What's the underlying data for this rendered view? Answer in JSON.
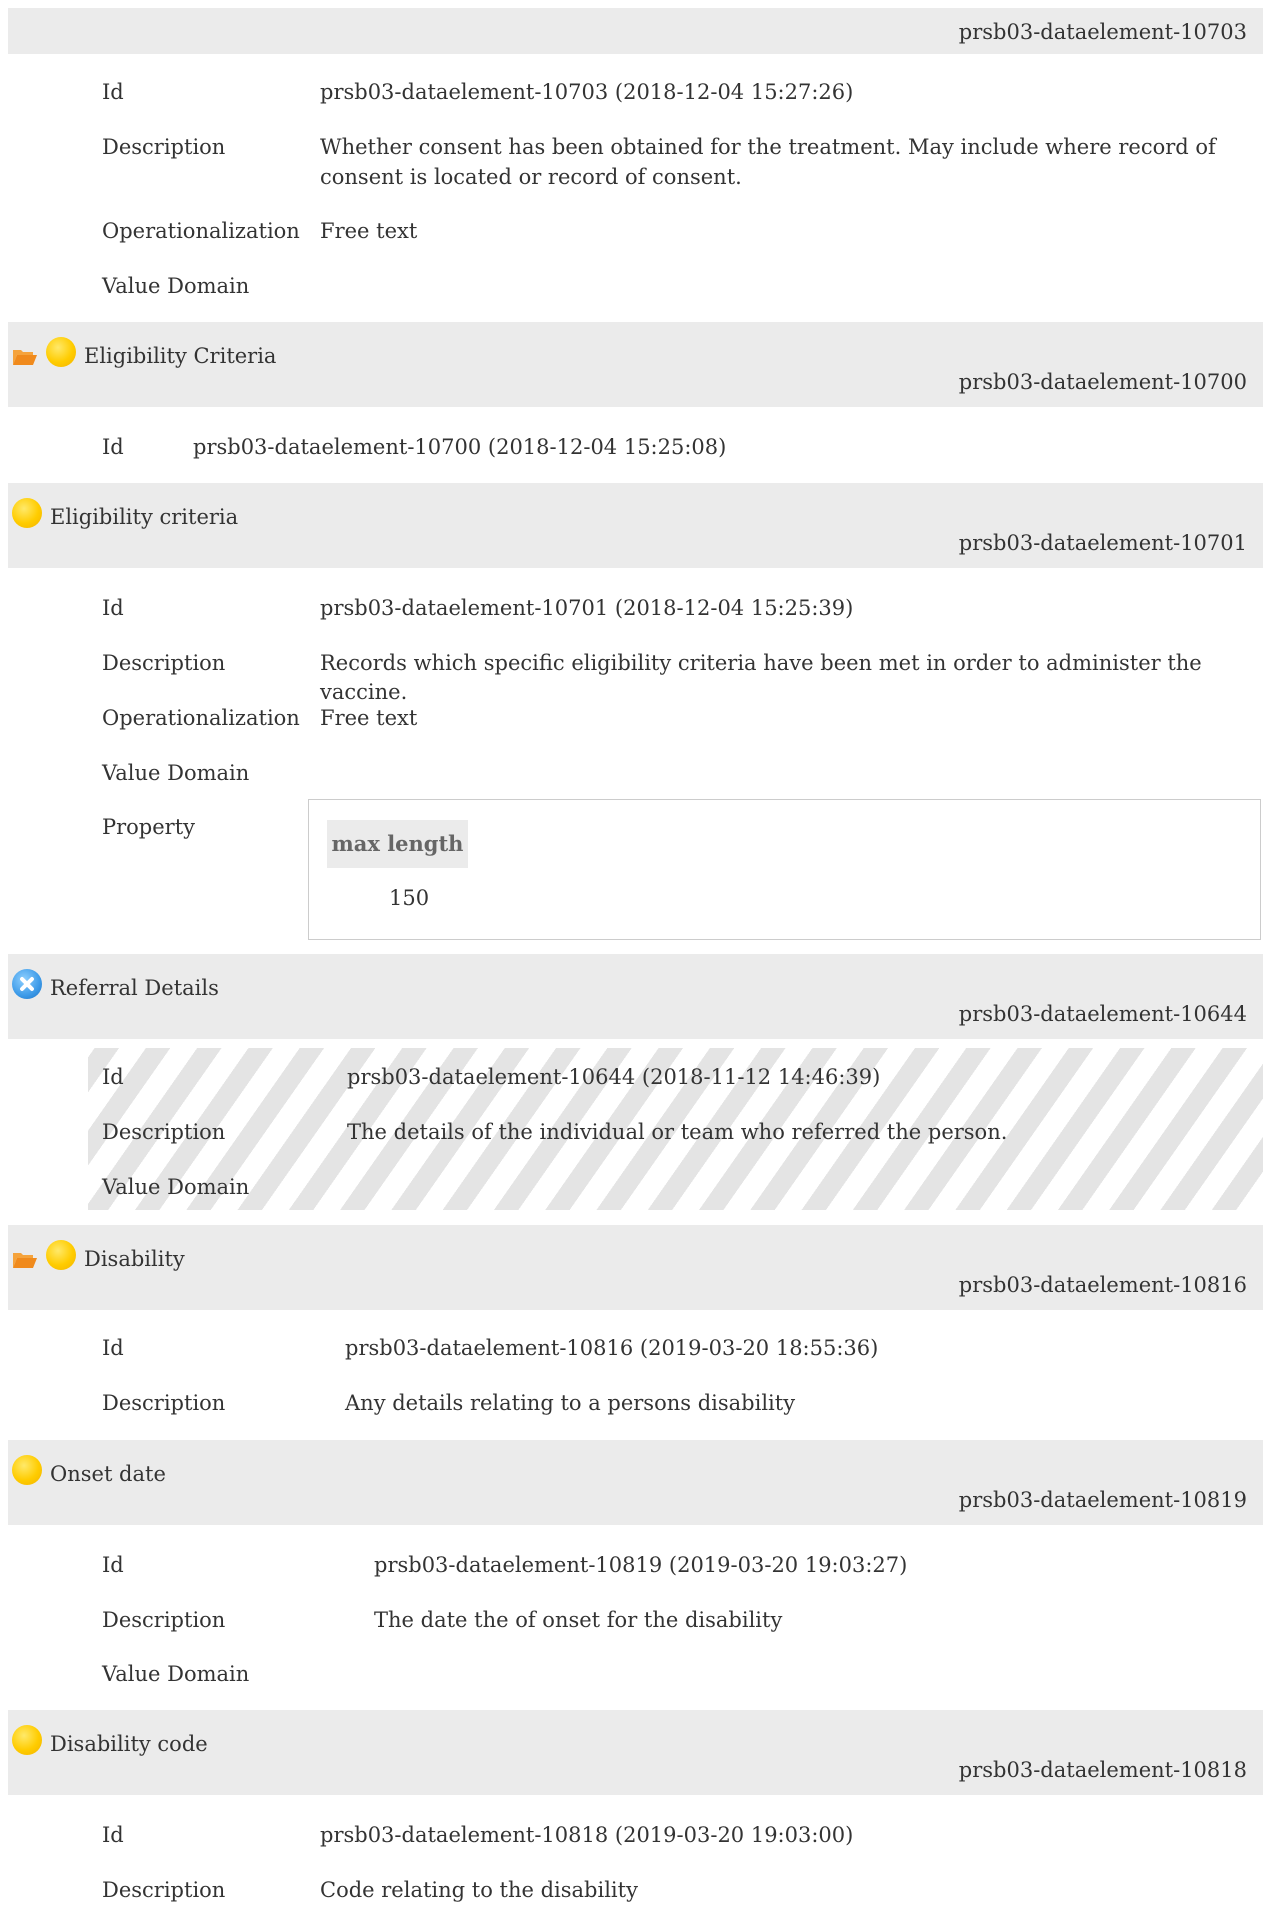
{
  "block1": {
    "header_id": "prsb03-dataelement-10703",
    "id_label": "Id",
    "id_value": "prsb03-dataelement-10703 (2018-12-04 15:27:26)",
    "description_label": "Description",
    "description_line1": "Whether consent has been obtained for the treatment. May include where record of",
    "description_line2": "consent is located or record of consent.",
    "operationalization_label": "Operationalization",
    "operationalization_value": "Free text",
    "value_domain_label": "Value Domain"
  },
  "block2": {
    "title": "Eligibility Criteria",
    "header_id": "prsb03-dataelement-10700",
    "id_label": "Id",
    "id_value": "prsb03-dataelement-10700 (2018-12-04 15:25:08)"
  },
  "block3": {
    "title": "Eligibility criteria",
    "header_id": "prsb03-dataelement-10701",
    "id_label": "Id",
    "id_value": "prsb03-dataelement-10701 (2018-12-04 15:25:39)",
    "description_label": "Description",
    "description_value": "Records which specific eligibility criteria have been met in order to administer the vaccine.",
    "operationalization_label": "Operationalization",
    "operationalization_value": "Free text",
    "value_domain_label": "Value Domain",
    "property_label": "Property",
    "property_header": "max length",
    "property_value": "150"
  },
  "block4": {
    "title": "Referral Details",
    "header_id": "prsb03-dataelement-10644",
    "id_label": "Id",
    "id_value": "prsb03-dataelement-10644 (2018-11-12 14:46:39)",
    "description_label": "Description",
    "description_value": "The details of the individual or team who referred the person.",
    "value_domain_label": "Value Domain"
  },
  "block5": {
    "title": "Disability",
    "header_id": "prsb03-dataelement-10816",
    "id_label": "Id",
    "id_value": "prsb03-dataelement-10816 (2019-03-20 18:55:36)",
    "description_label": "Description",
    "description_value": "Any details relating to a persons disability"
  },
  "block6": {
    "title": "Onset date",
    "header_id": "prsb03-dataelement-10819",
    "id_label": "Id",
    "id_value": "prsb03-dataelement-10819 (2019-03-20 19:03:27)",
    "description_label": "Description",
    "description_value": "The date the of onset for the disability",
    "value_domain_label": "Value Domain"
  },
  "block7": {
    "title": "Disability code",
    "header_id": "prsb03-dataelement-10818",
    "id_label": "Id",
    "id_value": "prsb03-dataelement-10818 (2019-03-20 19:03:00)",
    "description_label": "Description",
    "description_value": "Code relating to the disability"
  },
  "colors": {
    "header_bg": "#ebebeb",
    "status_draft": "#ffcc00",
    "status_cancelled": "#3c9ae8",
    "folder": "#f08a1c"
  }
}
